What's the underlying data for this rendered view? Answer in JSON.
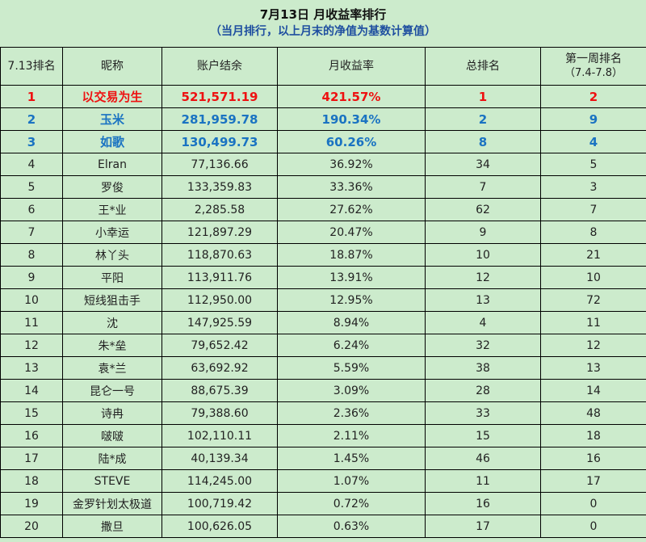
{
  "title": "7月13日 月收益率排行",
  "subtitle": "（当月排行，以上月末的净值为基数计算值）",
  "headers": {
    "rank": "7.13排名",
    "nickname": "昵称",
    "balance": "账户结余",
    "monthly_return": "月收益率",
    "overall_rank": "总排名",
    "week1_rank": "第一周排名",
    "week1_range": "（7.4-7.8）"
  },
  "colors": {
    "background": "#ccebcc",
    "first_place": "#ee1111",
    "top_three": "#1a73c2",
    "subtitle": "#1f4fa0"
  },
  "rows": [
    {
      "rank": "1",
      "nickname": "以交易为生",
      "balance": "521,571.19",
      "monthly_return": "421.57%",
      "overall_rank": "1",
      "week1_rank": "2"
    },
    {
      "rank": "2",
      "nickname": "玉米",
      "balance": "281,959.78",
      "monthly_return": "190.34%",
      "overall_rank": "2",
      "week1_rank": "9"
    },
    {
      "rank": "3",
      "nickname": "如歌",
      "balance": "130,499.73",
      "monthly_return": "60.26%",
      "overall_rank": "8",
      "week1_rank": "4"
    },
    {
      "rank": "4",
      "nickname": "Elran",
      "balance": "77,136.66",
      "monthly_return": "36.92%",
      "overall_rank": "34",
      "week1_rank": "5"
    },
    {
      "rank": "5",
      "nickname": "罗俊",
      "balance": "133,359.83",
      "monthly_return": "33.36%",
      "overall_rank": "7",
      "week1_rank": "3"
    },
    {
      "rank": "6",
      "nickname": "王*业",
      "balance": "2,285.58",
      "monthly_return": "27.62%",
      "overall_rank": "62",
      "week1_rank": "7"
    },
    {
      "rank": "7",
      "nickname": "小幸运",
      "balance": "121,897.29",
      "monthly_return": "20.47%",
      "overall_rank": "9",
      "week1_rank": "8"
    },
    {
      "rank": "8",
      "nickname": "林丫头",
      "balance": "118,870.63",
      "monthly_return": "18.87%",
      "overall_rank": "10",
      "week1_rank": "21"
    },
    {
      "rank": "9",
      "nickname": "平阳",
      "balance": "113,911.76",
      "monthly_return": "13.91%",
      "overall_rank": "12",
      "week1_rank": "10"
    },
    {
      "rank": "10",
      "nickname": "短线狙击手",
      "balance": "112,950.00",
      "monthly_return": "12.95%",
      "overall_rank": "13",
      "week1_rank": "72"
    },
    {
      "rank": "11",
      "nickname": "沈",
      "balance": "147,925.59",
      "monthly_return": "8.94%",
      "overall_rank": "4",
      "week1_rank": "11"
    },
    {
      "rank": "12",
      "nickname": "朱*垒",
      "balance": "79,652.42",
      "monthly_return": "6.24%",
      "overall_rank": "32",
      "week1_rank": "12"
    },
    {
      "rank": "13",
      "nickname": "袁*兰",
      "balance": "63,692.92",
      "monthly_return": "5.59%",
      "overall_rank": "38",
      "week1_rank": "13"
    },
    {
      "rank": "14",
      "nickname": "昆仑一号",
      "balance": "88,675.39",
      "monthly_return": "3.09%",
      "overall_rank": "28",
      "week1_rank": "14"
    },
    {
      "rank": "15",
      "nickname": "诗冉",
      "balance": "79,388.60",
      "monthly_return": "2.36%",
      "overall_rank": "33",
      "week1_rank": "48"
    },
    {
      "rank": "16",
      "nickname": "啵啵",
      "balance": "102,110.11",
      "monthly_return": "2.11%",
      "overall_rank": "15",
      "week1_rank": "18"
    },
    {
      "rank": "17",
      "nickname": "陆*成",
      "balance": "40,139.34",
      "monthly_return": "1.45%",
      "overall_rank": "46",
      "week1_rank": "16"
    },
    {
      "rank": "18",
      "nickname": "STEVE",
      "balance": "114,245.00",
      "monthly_return": "1.07%",
      "overall_rank": "11",
      "week1_rank": "17"
    },
    {
      "rank": "19",
      "nickname": "金罗针划太极道",
      "balance": "100,719.42",
      "monthly_return": "0.72%",
      "overall_rank": "16",
      "week1_rank": "0"
    },
    {
      "rank": "20",
      "nickname": "撒旦",
      "balance": "100,626.05",
      "monthly_return": "0.63%",
      "overall_rank": "17",
      "week1_rank": "0"
    }
  ]
}
